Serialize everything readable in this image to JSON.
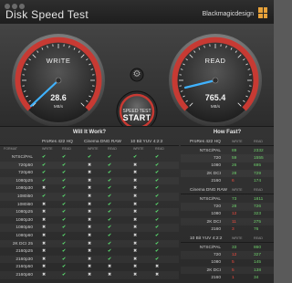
{
  "window": {
    "title": "Disk Speed Test",
    "brand": "Blackmagicdesign"
  },
  "gauges": {
    "write": {
      "label": "WRITE",
      "value": "28.6",
      "unit": "MB/s"
    },
    "read": {
      "label": "READ",
      "value": "765.4",
      "unit": "MB/s"
    },
    "start": {
      "sub": "SPEED TEST",
      "main": "START"
    }
  },
  "will_it_work": {
    "title": "Will It Work?",
    "groups": [
      "ProRes 422 HQ",
      "Cinema DNG RAW",
      "10 Bit YUV 4:2:2"
    ],
    "format_label": "FORMAT",
    "col_labels": [
      "WRITE",
      "READ",
      "WRITE",
      "READ",
      "WRITE",
      "READ"
    ],
    "rows": [
      {
        "format": "NTSC/PAL",
        "c": [
          "ok",
          "ok",
          "ok",
          "ok",
          "ok",
          "ok"
        ]
      },
      {
        "format": "720p50",
        "c": [
          "ok",
          "ok",
          "no",
          "ok",
          "no",
          "ok"
        ]
      },
      {
        "format": "720p60",
        "c": [
          "ok",
          "ok",
          "no",
          "ok",
          "no",
          "ok"
        ]
      },
      {
        "format": "1080p25",
        "c": [
          "ok",
          "ok",
          "no",
          "ok",
          "no",
          "ok"
        ]
      },
      {
        "format": "1080p30",
        "c": [
          "no",
          "ok",
          "no",
          "ok",
          "no",
          "ok"
        ]
      },
      {
        "format": "1080i50",
        "c": [
          "ok",
          "ok",
          "no",
          "ok",
          "no",
          "ok"
        ]
      },
      {
        "format": "1080i60",
        "c": [
          "no",
          "ok",
          "no",
          "ok",
          "no",
          "ok"
        ]
      },
      {
        "format": "1080p25",
        "c": [
          "no",
          "ok",
          "no",
          "ok",
          "no",
          "ok"
        ]
      },
      {
        "format": "1080p30",
        "c": [
          "no",
          "ok",
          "no",
          "ok",
          "no",
          "ok"
        ]
      },
      {
        "format": "1080p50",
        "c": [
          "no",
          "ok",
          "no",
          "ok",
          "no",
          "ok"
        ]
      },
      {
        "format": "1080p60",
        "c": [
          "no",
          "ok",
          "no",
          "ok",
          "no",
          "ok"
        ]
      },
      {
        "format": "2K DCI 25",
        "c": [
          "no",
          "ok",
          "no",
          "ok",
          "no",
          "ok"
        ]
      },
      {
        "format": "2160p25",
        "c": [
          "no",
          "ok",
          "no",
          "ok",
          "no",
          "ok"
        ]
      },
      {
        "format": "2160p30",
        "c": [
          "no",
          "ok",
          "no",
          "ok",
          "no",
          "ok"
        ]
      },
      {
        "format": "2160p50",
        "c": [
          "no",
          "ok",
          "no",
          "no",
          "no",
          "no"
        ]
      },
      {
        "format": "2160p60",
        "c": [
          "no",
          "ok",
          "no",
          "no",
          "no",
          "no"
        ]
      }
    ]
  },
  "how_fast": {
    "title": "How Fast?",
    "col_labels": [
      "WRITE",
      "READ"
    ],
    "groups": [
      {
        "name": "ProRes 422 HQ",
        "rows": [
          {
            "format": "NTSC/PAL",
            "write": "89",
            "read": "2332",
            "wc": "g"
          },
          {
            "format": "720",
            "write": "59",
            "read": "1555",
            "wc": "g"
          },
          {
            "format": "1080",
            "write": "26",
            "read": "695",
            "wc": "g"
          },
          {
            "format": "2K DCI",
            "write": "28",
            "read": "729",
            "wc": "g"
          },
          {
            "format": "2160",
            "write": "6",
            "read": "174",
            "wc": "r"
          }
        ]
      },
      {
        "name": "Cinema DNG RAW",
        "rows": [
          {
            "format": "NTSC/PAL",
            "write": "73",
            "read": "1811",
            "wc": "g"
          },
          {
            "format": "720",
            "write": "28",
            "read": "726",
            "wc": "g"
          },
          {
            "format": "1080",
            "write": "12",
            "read": "323",
            "wc": "r"
          },
          {
            "format": "2K DCI",
            "write": "11",
            "read": "275",
            "wc": "r"
          },
          {
            "format": "2160",
            "write": "3",
            "read": "76",
            "wc": "r"
          }
        ]
      },
      {
        "name": "10 Bit YUV 4:2:2",
        "rows": [
          {
            "format": "NTSC/PAL",
            "write": "33",
            "read": "860",
            "wc": "g"
          },
          {
            "format": "720",
            "write": "12",
            "read": "327",
            "wc": "r"
          },
          {
            "format": "1080",
            "write": "5",
            "read": "145",
            "wc": "r"
          },
          {
            "format": "2K DCI",
            "write": "5",
            "read": "138",
            "wc": "r"
          },
          {
            "format": "2160",
            "write": "1",
            "read": "34",
            "wc": "r"
          }
        ]
      }
    ]
  }
}
